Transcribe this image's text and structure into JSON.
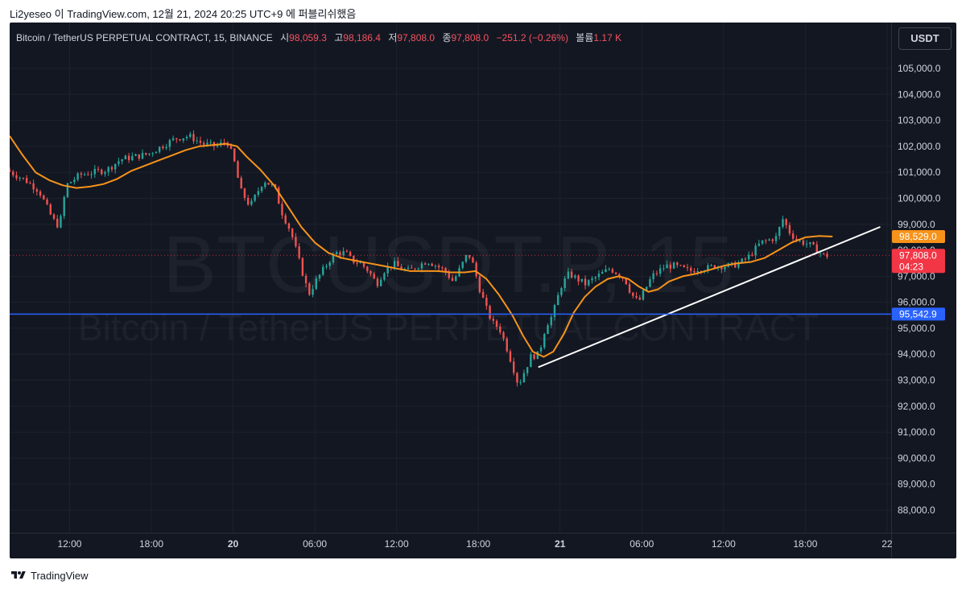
{
  "header": {
    "text": "Li2yeseo 이 TradingView.com, 12월 21, 2024 20:25 UTC+9 에 퍼블리쉬했음"
  },
  "legend": {
    "symbol": "Bitcoin / TetherUS PERPETUAL CONTRACT, 15, BINANCE",
    "open_label": "시",
    "open": "98,059.3",
    "high_label": "고",
    "high": "98,186.4",
    "low_label": "저",
    "low": "97,808.0",
    "close_label": "종",
    "close": "97,808.0",
    "change": "−251.2 (−0.26%)",
    "volume_label": "볼륨",
    "volume": "1.17 K"
  },
  "currency_button": "USDT",
  "watermark": {
    "ticker": "BTCUSDT.P, 15",
    "description": "Bitcoin / TetherUS PERPETUAL CONTRACT"
  },
  "footer": {
    "brand": "TradingView"
  },
  "colors": {
    "background": "#131722",
    "up": "#26a69a",
    "down": "#ef5350",
    "ma": "#f7931a",
    "trendline": "#ffffff",
    "horizontal_line": "#2962ff",
    "text": "#d1d4dc",
    "grid": "#1e222d"
  },
  "chart_data": {
    "type": "candlestick",
    "ylim": [
      87000,
      106000
    ],
    "y_ticks": [
      88000,
      89000,
      90000,
      91000,
      92000,
      93000,
      94000,
      95000,
      96000,
      97000,
      98000,
      99000,
      100000,
      101000,
      102000,
      103000,
      104000,
      105000
    ],
    "y_tick_labels": [
      "88,000.0",
      "89,000.0",
      "90,000.0",
      "91,000.0",
      "92,000.0",
      "93,000.0",
      "94,000.0",
      "95,000.0",
      "96,000.0",
      "97,000.0",
      "98,000.0",
      "99,000.0",
      "100,000.0",
      "101,000.0",
      "102,000.0",
      "103,000.0",
      "104,000.0",
      "105,000.0"
    ],
    "x_ticks": [
      {
        "t": 12,
        "label": "12:00",
        "bold": false
      },
      {
        "t": 18,
        "label": "18:00",
        "bold": false
      },
      {
        "t": 24,
        "label": "20",
        "bold": true
      },
      {
        "t": 30,
        "label": "06:00",
        "bold": false
      },
      {
        "t": 36,
        "label": "12:00",
        "bold": false
      },
      {
        "t": 42,
        "label": "18:00",
        "bold": false
      },
      {
        "t": 48,
        "label": "21",
        "bold": true
      },
      {
        "t": 54,
        "label": "06:00",
        "bold": false
      },
      {
        "t": 60,
        "label": "12:00",
        "bold": false
      },
      {
        "t": 66,
        "label": "18:00",
        "bold": false
      },
      {
        "t": 72,
        "label": "22",
        "bold": false
      }
    ],
    "xlim_hours": [
      7.6,
      72.3
    ],
    "price_path": [
      [
        7.6,
        101100
      ],
      [
        9.0,
        100700
      ],
      [
        10.0,
        100300
      ],
      [
        11.0,
        99200
      ],
      [
        11.5,
        98900
      ],
      [
        12.0,
        100500
      ],
      [
        13.0,
        100900
      ],
      [
        14.0,
        101000
      ],
      [
        15.0,
        101100
      ],
      [
        16.0,
        101500
      ],
      [
        17.0,
        101600
      ],
      [
        18.0,
        101700
      ],
      [
        19.0,
        102000
      ],
      [
        20.0,
        102300
      ],
      [
        21.0,
        102400
      ],
      [
        22.0,
        102100
      ],
      [
        23.0,
        102000
      ],
      [
        23.8,
        102200
      ],
      [
        24.3,
        101500
      ],
      [
        24.8,
        100300
      ],
      [
        25.5,
        99700
      ],
      [
        26.5,
        100700
      ],
      [
        27.3,
        100400
      ],
      [
        27.8,
        99500
      ],
      [
        28.5,
        98700
      ],
      [
        29.2,
        97400
      ],
      [
        29.8,
        96300
      ],
      [
        30.3,
        96800
      ],
      [
        30.8,
        97200
      ],
      [
        31.3,
        97600
      ],
      [
        31.8,
        97900
      ],
      [
        32.5,
        97900
      ],
      [
        33.0,
        97600
      ],
      [
        33.6,
        97500
      ],
      [
        34.2,
        97200
      ],
      [
        34.8,
        96700
      ],
      [
        35.3,
        97200
      ],
      [
        36.0,
        97500
      ],
      [
        36.5,
        97300
      ],
      [
        37.2,
        97200
      ],
      [
        37.8,
        97400
      ],
      [
        38.5,
        97600
      ],
      [
        39.2,
        97400
      ],
      [
        39.8,
        97200
      ],
      [
        40.4,
        96800
      ],
      [
        41.0,
        97400
      ],
      [
        41.5,
        97900
      ],
      [
        41.9,
        97400
      ],
      [
        42.3,
        96600
      ],
      [
        42.8,
        95800
      ],
      [
        43.3,
        95200
      ],
      [
        43.8,
        95000
      ],
      [
        44.3,
        94300
      ],
      [
        44.8,
        93500
      ],
      [
        45.2,
        92800
      ],
      [
        45.6,
        93300
      ],
      [
        46.1,
        93900
      ],
      [
        46.7,
        94000
      ],
      [
        47.2,
        95100
      ],
      [
        47.7,
        95500
      ],
      [
        48.3,
        96600
      ],
      [
        48.9,
        97100
      ],
      [
        49.5,
        96900
      ],
      [
        50.1,
        96700
      ],
      [
        50.7,
        96900
      ],
      [
        51.3,
        97100
      ],
      [
        51.9,
        97300
      ],
      [
        52.5,
        97100
      ],
      [
        53.0,
        96900
      ],
      [
        53.5,
        96300
      ],
      [
        54.0,
        96000
      ],
      [
        54.5,
        96500
      ],
      [
        55.0,
        97000
      ],
      [
        55.5,
        97200
      ],
      [
        56.0,
        97400
      ],
      [
        56.6,
        97400
      ],
      [
        57.2,
        97300
      ],
      [
        57.8,
        97200
      ],
      [
        58.4,
        97300
      ],
      [
        59.0,
        97300
      ],
      [
        59.6,
        97400
      ],
      [
        60.2,
        97400
      ],
      [
        60.8,
        97400
      ],
      [
        61.4,
        97500
      ],
      [
        62.0,
        97700
      ],
      [
        62.5,
        98000
      ],
      [
        63.0,
        98300
      ],
      [
        63.6,
        98400
      ],
      [
        64.1,
        98500
      ],
      [
        64.6,
        99200
      ],
      [
        65.1,
        98700
      ],
      [
        65.6,
        98400
      ],
      [
        66.1,
        98300
      ],
      [
        66.6,
        98200
      ],
      [
        67.1,
        98000
      ],
      [
        67.6,
        97800
      ]
    ],
    "moving_average": [
      [
        7.6,
        102400
      ],
      [
        8.5,
        101700
      ],
      [
        9.5,
        101000
      ],
      [
        10.5,
        100700
      ],
      [
        11.5,
        100500
      ],
      [
        12.5,
        100400
      ],
      [
        13.5,
        100450
      ],
      [
        14.5,
        100550
      ],
      [
        15.5,
        100750
      ],
      [
        16.5,
        101050
      ],
      [
        17.5,
        101250
      ],
      [
        18.5,
        101450
      ],
      [
        19.5,
        101650
      ],
      [
        20.5,
        101850
      ],
      [
        21.5,
        102000
      ],
      [
        22.5,
        102050
      ],
      [
        23.5,
        102100
      ],
      [
        24.3,
        102000
      ],
      [
        25.0,
        101600
      ],
      [
        26.0,
        101100
      ],
      [
        27.0,
        100500
      ],
      [
        28.0,
        99700
      ],
      [
        29.0,
        98900
      ],
      [
        30.0,
        98300
      ],
      [
        31.0,
        97900
      ],
      [
        32.0,
        97700
      ],
      [
        33.0,
        97600
      ],
      [
        34.0,
        97500
      ],
      [
        35.0,
        97400
      ],
      [
        36.0,
        97300
      ],
      [
        37.0,
        97200
      ],
      [
        38.0,
        97200
      ],
      [
        39.0,
        97200
      ],
      [
        40.0,
        97150
      ],
      [
        41.0,
        97150
      ],
      [
        41.8,
        97200
      ],
      [
        42.6,
        96900
      ],
      [
        43.5,
        96300
      ],
      [
        44.5,
        95500
      ],
      [
        45.3,
        94700
      ],
      [
        46.0,
        94100
      ],
      [
        46.8,
        93900
      ],
      [
        47.5,
        94100
      ],
      [
        48.3,
        94800
      ],
      [
        49.0,
        95600
      ],
      [
        49.8,
        96200
      ],
      [
        50.6,
        96600
      ],
      [
        51.5,
        96900
      ],
      [
        52.3,
        97000
      ],
      [
        53.0,
        96900
      ],
      [
        53.8,
        96600
      ],
      [
        54.5,
        96400
      ],
      [
        55.2,
        96500
      ],
      [
        56.0,
        96800
      ],
      [
        57.0,
        97000
      ],
      [
        58.0,
        97100
      ],
      [
        59.0,
        97250
      ],
      [
        60.0,
        97400
      ],
      [
        61.0,
        97500
      ],
      [
        62.0,
        97550
      ],
      [
        63.0,
        97700
      ],
      [
        64.0,
        98000
      ],
      [
        65.0,
        98300
      ],
      [
        66.0,
        98500
      ],
      [
        67.0,
        98550
      ],
      [
        68.0,
        98529
      ]
    ],
    "trendline": [
      [
        46.4,
        93500
      ],
      [
        71.5,
        98900
      ]
    ],
    "horizontal_level": 95542.9,
    "price_labels": [
      {
        "value": 98529.0,
        "text": "98,529.0",
        "color": "#f7931a",
        "subtext": ""
      },
      {
        "value": 97808.0,
        "text": "97,808.0",
        "color": "#f23645",
        "subtext": "04:23"
      },
      {
        "value": 95542.9,
        "text": "95,542.9",
        "color": "#2962ff",
        "subtext": ""
      }
    ]
  }
}
